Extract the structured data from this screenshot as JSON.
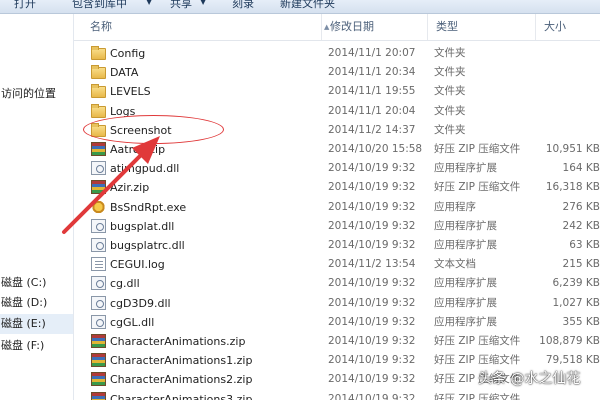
{
  "toolbar": {
    "items": [
      "打开",
      "包含到库中",
      "共享",
      "刻录",
      "新建文件夹"
    ]
  },
  "nav": {
    "items": [
      {
        "label": "访问的位置"
      },
      {
        "label": "磁盘 (C:)"
      },
      {
        "label": "磁盘 (D:)"
      },
      {
        "label": "磁盘 (E:)"
      },
      {
        "label": "磁盘 (F:)"
      }
    ]
  },
  "columns": [
    "名称",
    "修改日期",
    "类型",
    "大小"
  ],
  "files": [
    {
      "name": "Config",
      "date": "2014/11/1 20:07",
      "type": "文件夹",
      "size": "",
      "icon": "folder"
    },
    {
      "name": "DATA",
      "date": "2014/11/1 20:34",
      "type": "文件夹",
      "size": "",
      "icon": "folder"
    },
    {
      "name": "LEVELS",
      "date": "2014/11/1 19:55",
      "type": "文件夹",
      "size": "",
      "icon": "folder"
    },
    {
      "name": "Logs",
      "date": "2014/11/1 20:04",
      "type": "文件夹",
      "size": "",
      "icon": "folder"
    },
    {
      "name": "Screenshot",
      "date": "2014/11/2 14:37",
      "type": "文件夹",
      "size": "",
      "icon": "folder"
    },
    {
      "name": "Aatrox.zip",
      "date": "2014/10/20 15:58",
      "type": "好压 ZIP 压缩文件",
      "size": "10,951 KB",
      "icon": "zip"
    },
    {
      "name": "atimgpud.dll",
      "date": "2014/10/19 9:32",
      "type": "应用程序扩展",
      "size": "164 KB",
      "icon": "dll"
    },
    {
      "name": "Azir.zip",
      "date": "2014/10/19 9:32",
      "type": "好压 ZIP 压缩文件",
      "size": "16,318 KB",
      "icon": "zip"
    },
    {
      "name": "BsSndRpt.exe",
      "date": "2014/10/19 9:32",
      "type": "应用程序",
      "size": "276 KB",
      "icon": "exe"
    },
    {
      "name": "bugsplat.dll",
      "date": "2014/10/19 9:32",
      "type": "应用程序扩展",
      "size": "242 KB",
      "icon": "dll"
    },
    {
      "name": "bugsplatrc.dll",
      "date": "2014/10/19 9:32",
      "type": "应用程序扩展",
      "size": "63 KB",
      "icon": "dll"
    },
    {
      "name": "CEGUI.log",
      "date": "2014/11/2 13:54",
      "type": "文本文档",
      "size": "215 KB",
      "icon": "log"
    },
    {
      "name": "cg.dll",
      "date": "2014/10/19 9:32",
      "type": "应用程序扩展",
      "size": "6,239 KB",
      "icon": "dll"
    },
    {
      "name": "cgD3D9.dll",
      "date": "2014/10/19 9:32",
      "type": "应用程序扩展",
      "size": "1,027 KB",
      "icon": "dll"
    },
    {
      "name": "cgGL.dll",
      "date": "2014/10/19 9:32",
      "type": "应用程序扩展",
      "size": "355 KB",
      "icon": "dll"
    },
    {
      "name": "CharacterAnimations.zip",
      "date": "2014/10/19 9:32",
      "type": "好压 ZIP 压缩文件",
      "size": "108,879 KB",
      "icon": "zip"
    },
    {
      "name": "CharacterAnimations1.zip",
      "date": "2014/10/19 9:32",
      "type": "好压 ZIP 压缩文件",
      "size": "79,518 KB",
      "icon": "zip"
    },
    {
      "name": "CharacterAnimations2.zip",
      "date": "2014/10/19 9:32",
      "type": "好压 ZIP 压缩文件",
      "size": "",
      "icon": "zip"
    },
    {
      "name": "CharacterAnimations3.zip",
      "date": "2014/10/19 9:32",
      "type": "好压 ZIP 压缩文件",
      "size": "",
      "icon": "zip"
    }
  ],
  "watermark": "头条 @水之仙花",
  "colors": {
    "highlight_annotation": "#e0393a",
    "selected_nav": "#e5eef8"
  }
}
